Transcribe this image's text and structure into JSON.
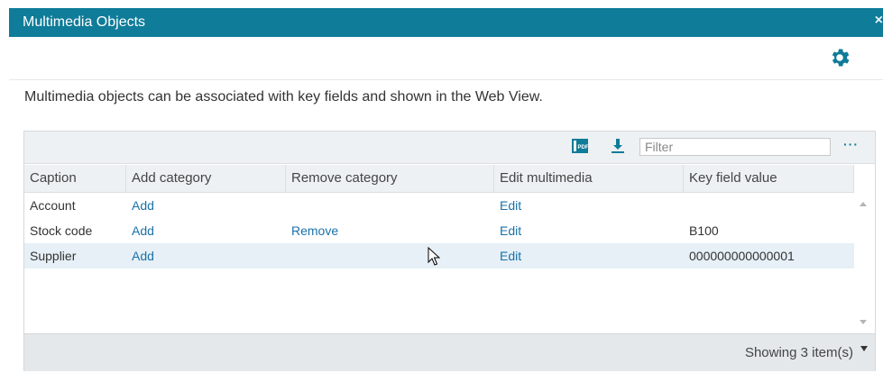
{
  "window": {
    "title": "Multimedia Objects",
    "close_glyph": "×"
  },
  "toolbar": {
    "settings_icon": "gear-icon",
    "accent": "#0f7c99"
  },
  "description": "Multimedia objects can be associated with key fields and shown in the Web View.",
  "grid": {
    "tools": {
      "pdf_icon": "pdf-export-icon",
      "download_icon": "download-icon",
      "filter_placeholder": "Filter",
      "filter_value": "",
      "more_label": "···"
    },
    "columns": [
      "Caption",
      "Add category",
      "Remove category",
      "Edit multimedia",
      "Key field value"
    ],
    "rows": [
      {
        "caption": "Account",
        "add": "Add",
        "remove": "",
        "edit": "Edit",
        "key": ""
      },
      {
        "caption": "Stock code",
        "add": "Add",
        "remove": "Remove",
        "edit": "Edit",
        "key": "B100"
      },
      {
        "caption": "Supplier",
        "add": "Add",
        "remove": "",
        "edit": "Edit",
        "key": "000000000000001"
      }
    ],
    "footer": {
      "count_text": "Showing 3 item(s)"
    }
  }
}
